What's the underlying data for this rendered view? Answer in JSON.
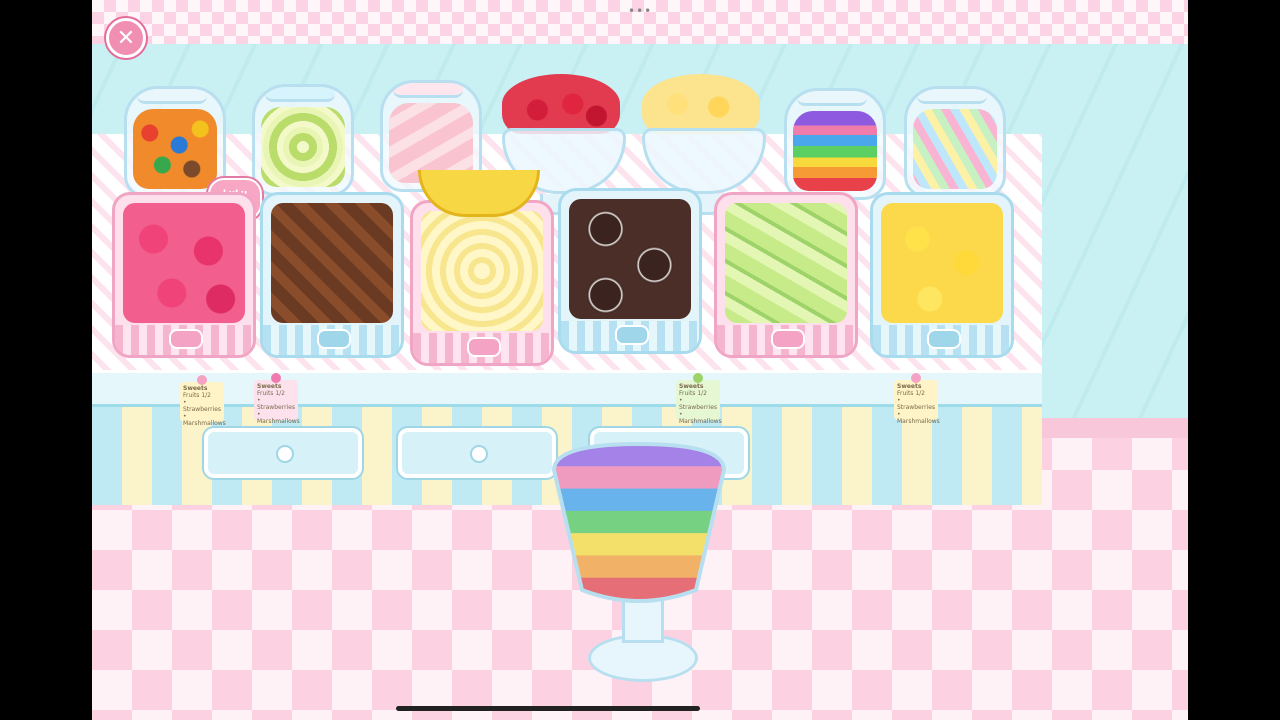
{
  "app": {
    "close_icon": "close-icon",
    "more_icon": "more-dots-icon",
    "more_glyph": "•••",
    "close_glyph": "✕"
  },
  "colors": {
    "wall": "#c9f0f2",
    "floor_pink": "#fcd2e3",
    "accent_pink": "#f08fb2",
    "counter_blue": "#bfe9f3",
    "counter_yellow": "#fbf3c9"
  },
  "shop": {
    "heart_sign": "LuLu BEAM",
    "jars": [
      {
        "name": "candy-coated-chocolates-jar",
        "icon": "candy-jar-icon"
      },
      {
        "name": "kiwi-slices-jar",
        "icon": "kiwi-jar-icon"
      },
      {
        "name": "marshmallows-jar",
        "icon": "marshmallow-jar-icon"
      },
      {
        "name": "cherries-bowl",
        "icon": "cherry-bowl-icon"
      },
      {
        "name": "cheese-bowl",
        "icon": "cheese-bowl-icon"
      },
      {
        "name": "rainbow-jelly-beans-jar",
        "icon": "jelly-bean-jar-icon"
      },
      {
        "name": "rainbow-marshmallow-twists-jar",
        "icon": "twist-jar-icon"
      }
    ],
    "bins": [
      {
        "name": "strawberries-bin",
        "icon": "strawberry-icon"
      },
      {
        "name": "chocolate-hearts-bin",
        "icon": "chocolate-icon"
      },
      {
        "name": "banana-slices-bin",
        "icon": "banana-icon"
      },
      {
        "name": "sandwich-cookies-bin",
        "icon": "cookie-icon"
      },
      {
        "name": "melon-bin",
        "icon": "melon-icon"
      },
      {
        "name": "star-fruit-bin",
        "icon": "star-fruit-icon"
      }
    ],
    "recipe_cards": [
      {
        "title": "Sweets",
        "lines": [
          "Fruits 1/2",
          "• Strawberries",
          "• Marshmallows"
        ]
      },
      {
        "title": "Sweets",
        "lines": [
          "Fruits 1/2",
          "• Strawberries",
          "• Marshmallows"
        ]
      },
      {
        "title": "Sweets",
        "lines": [
          "Fruits 1/2",
          "• Strawberries",
          "• Marshmallows"
        ]
      },
      {
        "title": "Sweets",
        "lines": [
          "Fruits 1/2",
          "• Strawberries",
          "• Marshmallows"
        ]
      }
    ]
  },
  "sundae": {
    "name": "rainbow-parfait-cup",
    "layers": [
      "purple",
      "pink",
      "blue",
      "green",
      "yellow",
      "orange",
      "red"
    ]
  }
}
